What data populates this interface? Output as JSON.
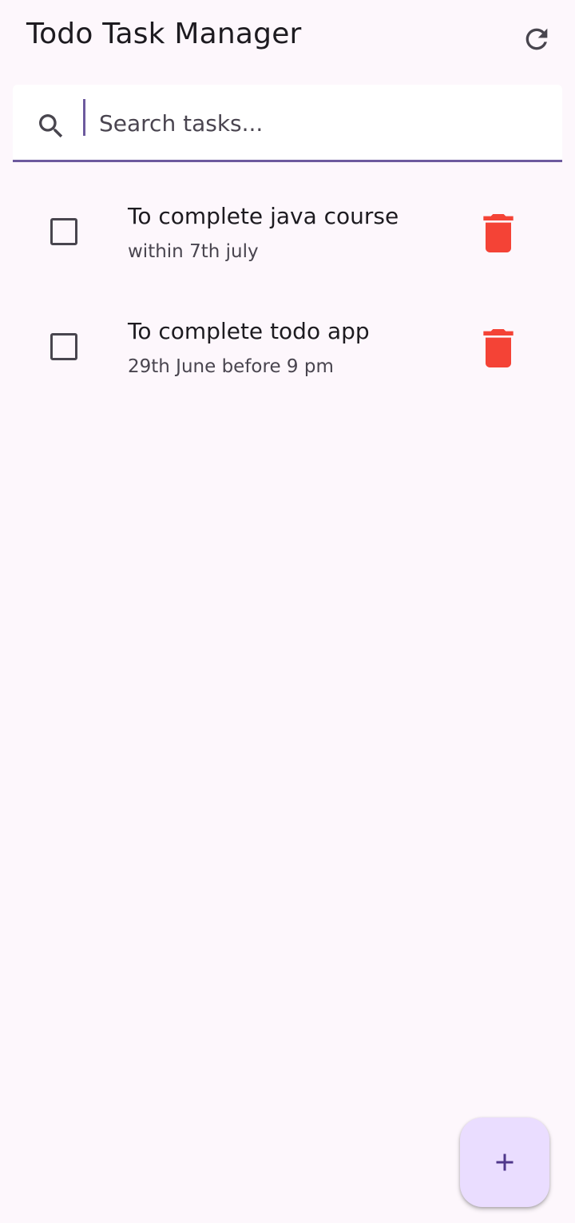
{
  "app_bar": {
    "title": "Todo Task Manager",
    "refresh_icon": "refresh-icon"
  },
  "search": {
    "placeholder": "Search tasks...",
    "value": "",
    "icon": "search-icon"
  },
  "tasks": [
    {
      "title": "To complete java course",
      "subtitle": "within 7th july",
      "checked": false
    },
    {
      "title": "To complete todo app",
      "subtitle": "29th June before 9 pm",
      "checked": false
    }
  ],
  "fab": {
    "icon": "plus-icon"
  },
  "colors": {
    "background": "#fdf7fc",
    "accent": "#6d5a9e",
    "delete": "#f44336",
    "fab": "#eaddff"
  }
}
